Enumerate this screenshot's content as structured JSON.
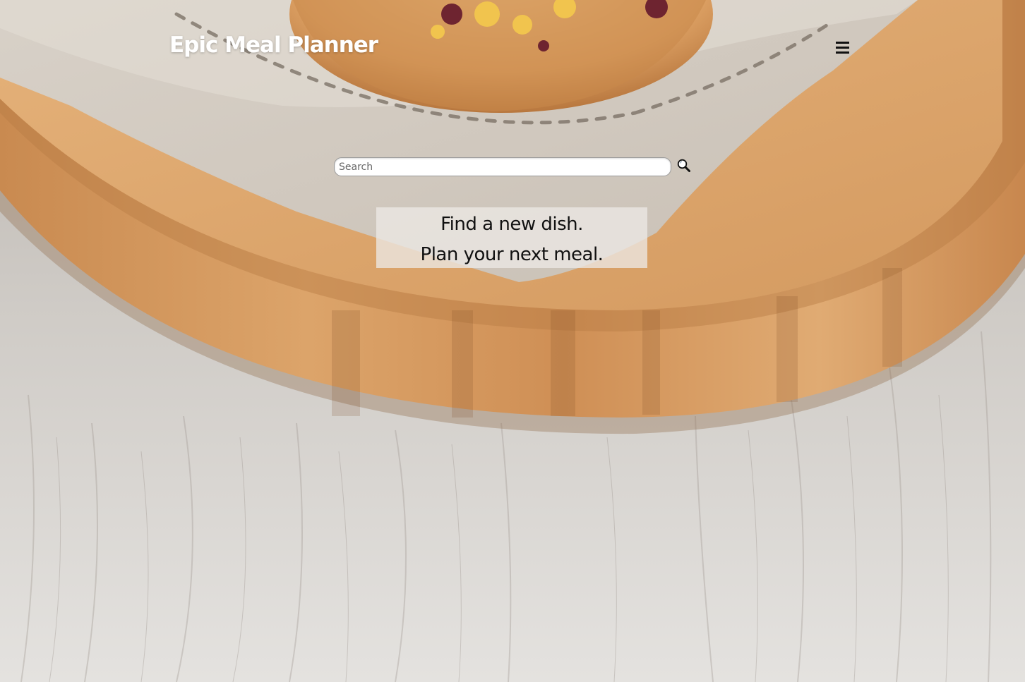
{
  "header": {
    "title": "Epic Meal Planner",
    "menu_icon": "hamburger-menu-icon"
  },
  "search": {
    "placeholder": "Search",
    "value": "",
    "button_icon": "magnifier-icon"
  },
  "hero": {
    "line1": "Find a new dish.",
    "line2": "Plan your next meal."
  },
  "colors": {
    "title_text": "#ffffff",
    "tagline_background": "#ece8e4",
    "wood_board": "#d69a5e",
    "napkin": "#cfc7bd",
    "table_surface": "#d9d6d2"
  }
}
